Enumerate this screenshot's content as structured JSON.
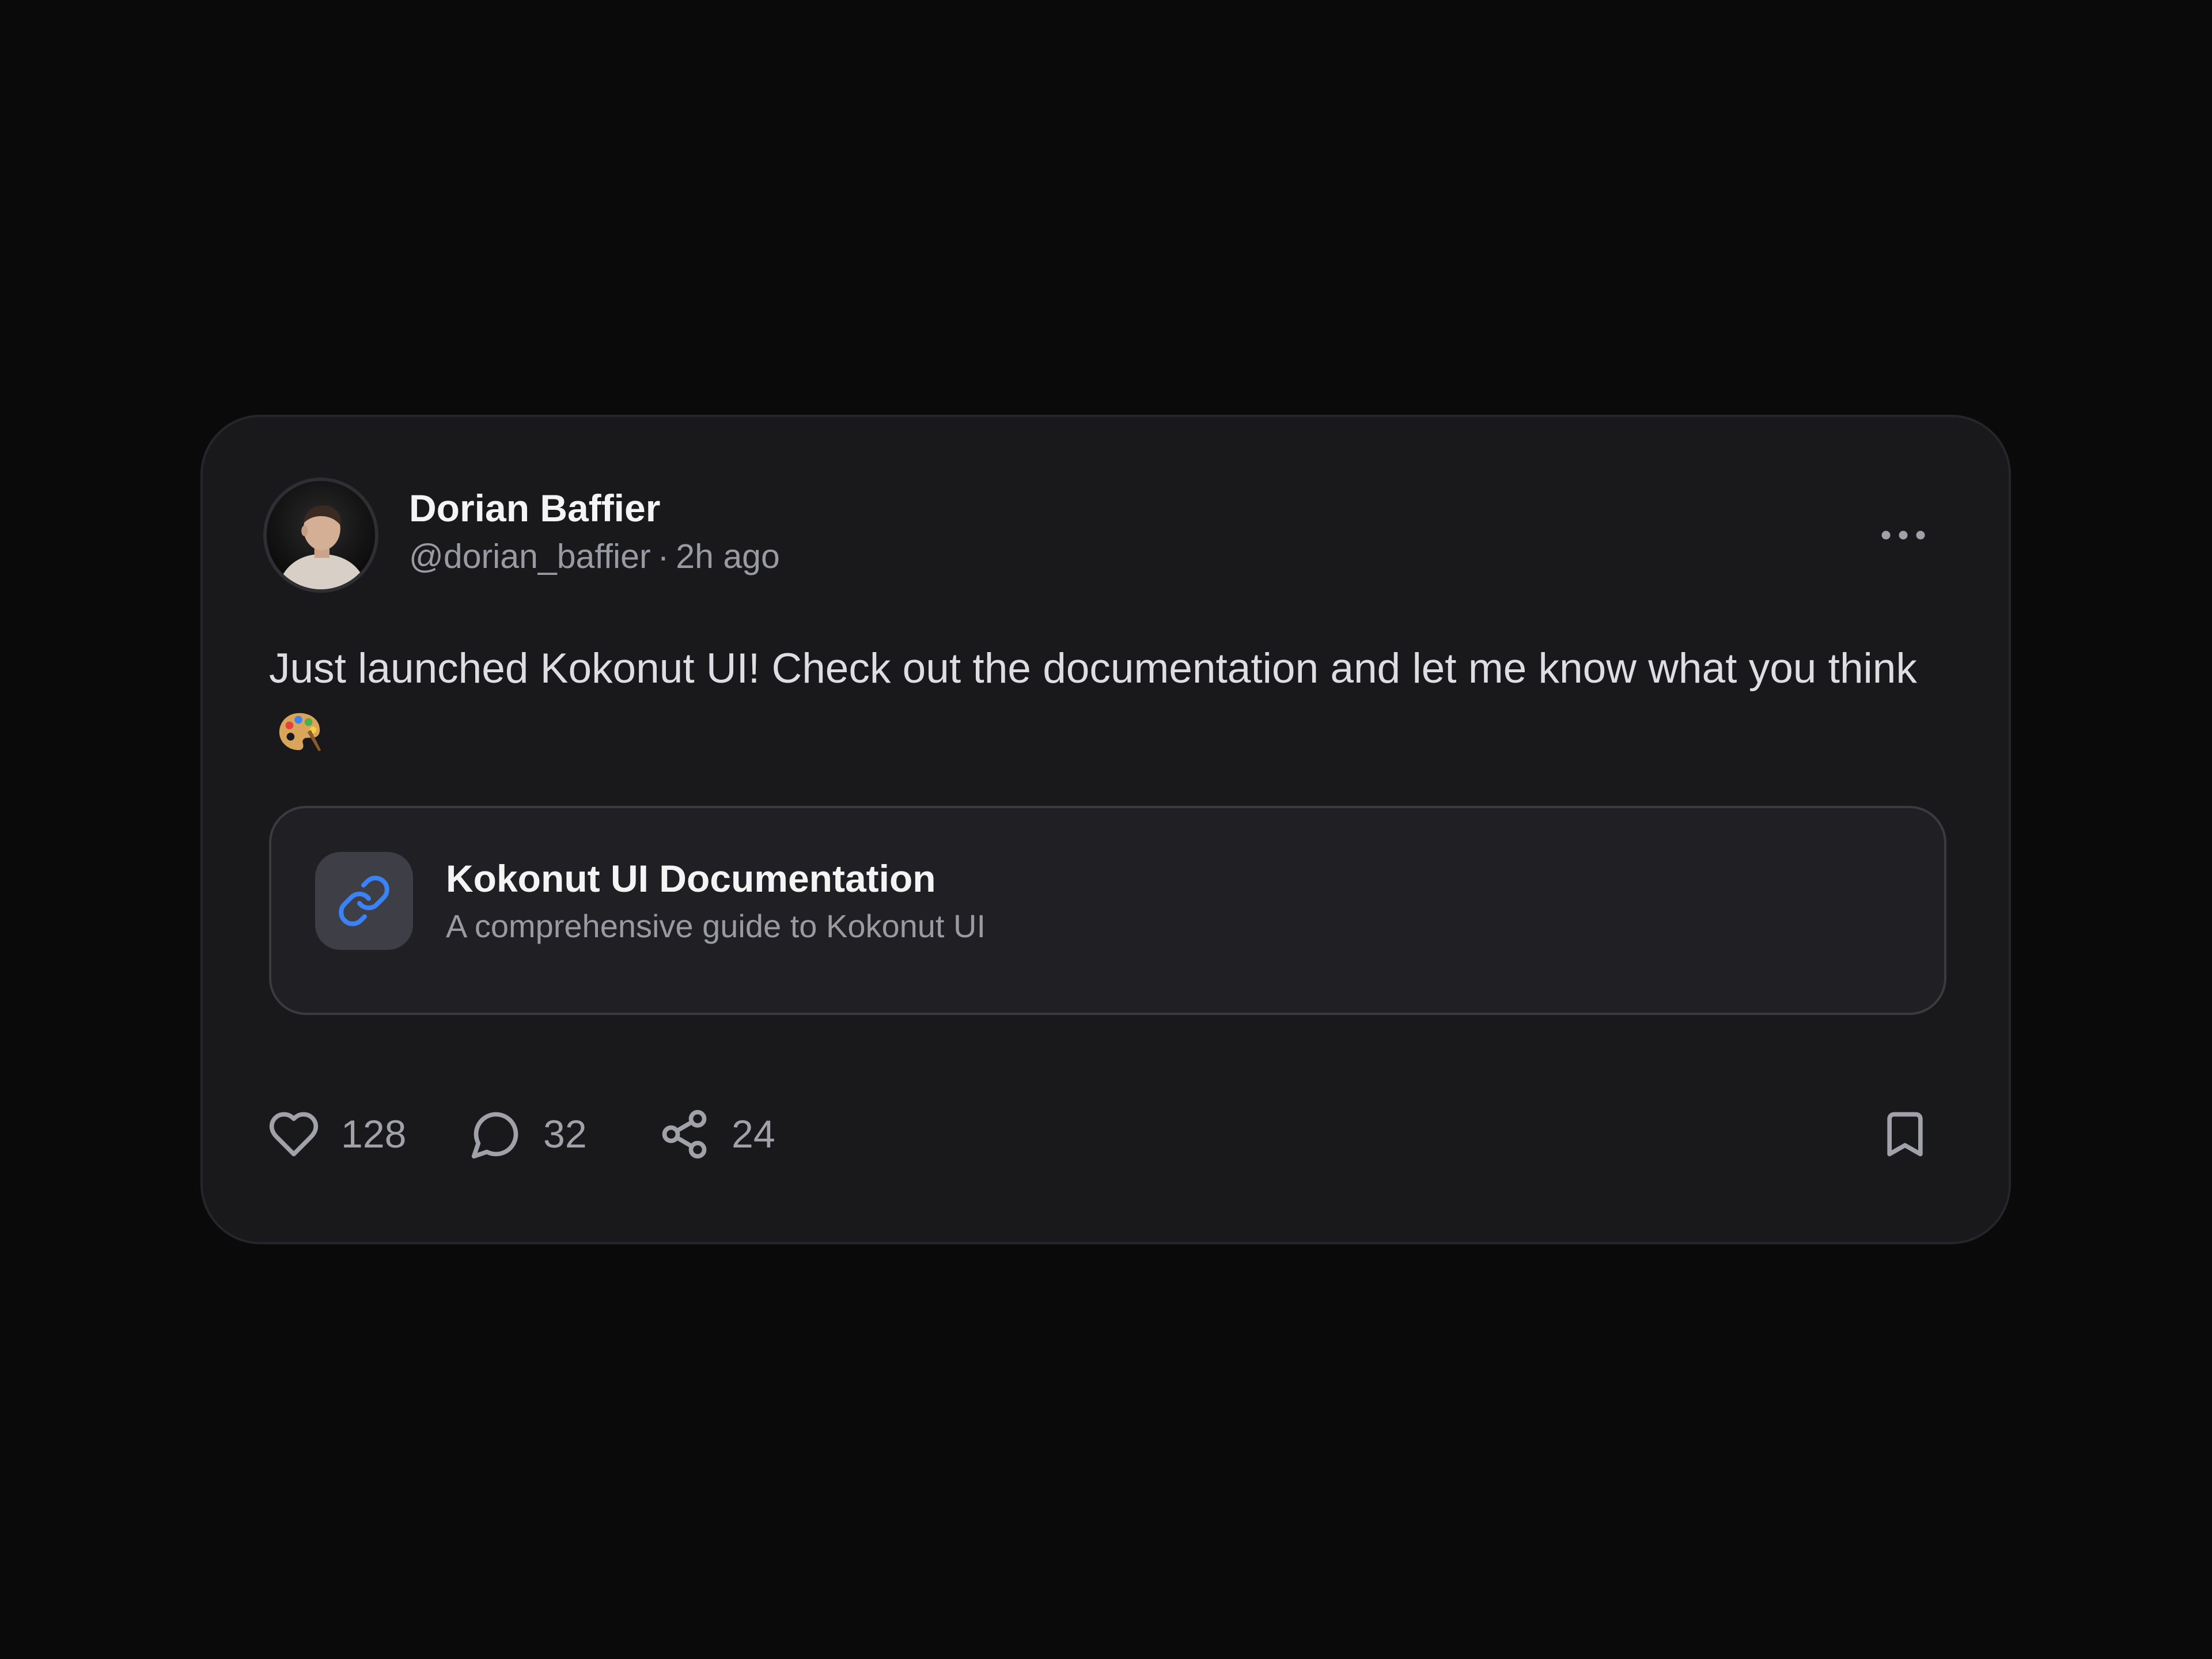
{
  "post": {
    "author": {
      "name": "Dorian Baffier",
      "handle": "@dorian_baffier",
      "separator": "·",
      "time": "2h ago",
      "avatar_icon": "avatar-photo"
    },
    "text": "Just launched Kokonut UI! Check out the documentation and let me know what you think",
    "emoji": "palette-emoji",
    "menu_icon": "more-horizontal-icon"
  },
  "link_preview": {
    "icon": "link-icon",
    "title": "Kokonut UI Documentation",
    "description": "A comprehensive guide to Kokonut UI",
    "accent_color": "#3b82f6"
  },
  "actions": {
    "likes": {
      "icon": "heart-icon",
      "count": "128"
    },
    "comments": {
      "icon": "message-circle-icon",
      "count": "32"
    },
    "shares": {
      "icon": "share-icon",
      "count": "24"
    },
    "bookmark": {
      "icon": "bookmark-icon"
    }
  },
  "colors": {
    "page_background": "#0a0a0b",
    "card_background": "#19191c",
    "text_primary": "#f4f4f5",
    "text_secondary": "#9a9aa3"
  }
}
